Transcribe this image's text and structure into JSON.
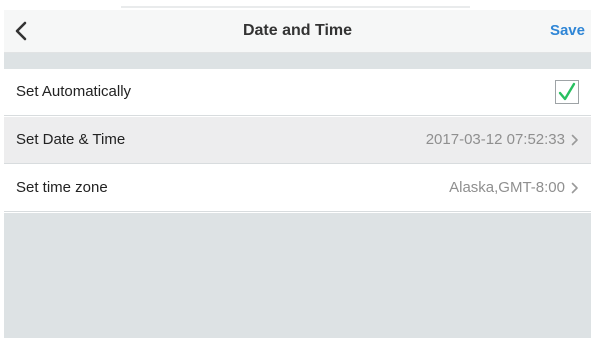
{
  "header": {
    "title": "Date and Time",
    "save_label": "Save"
  },
  "rows": [
    {
      "label": "Set Automatically",
      "checked": true
    },
    {
      "label": "Set Date & Time",
      "value": "2017-03-12 07:52:33"
    },
    {
      "label": "Set time zone",
      "value": "Alaska,GMT-8:00"
    }
  ],
  "colors": {
    "accent": "#2f86d6",
    "check": "#28c060"
  },
  "icons": {
    "back": "chevron-left-icon",
    "disclosure": "chevron-right-icon",
    "check": "checkmark-icon"
  }
}
